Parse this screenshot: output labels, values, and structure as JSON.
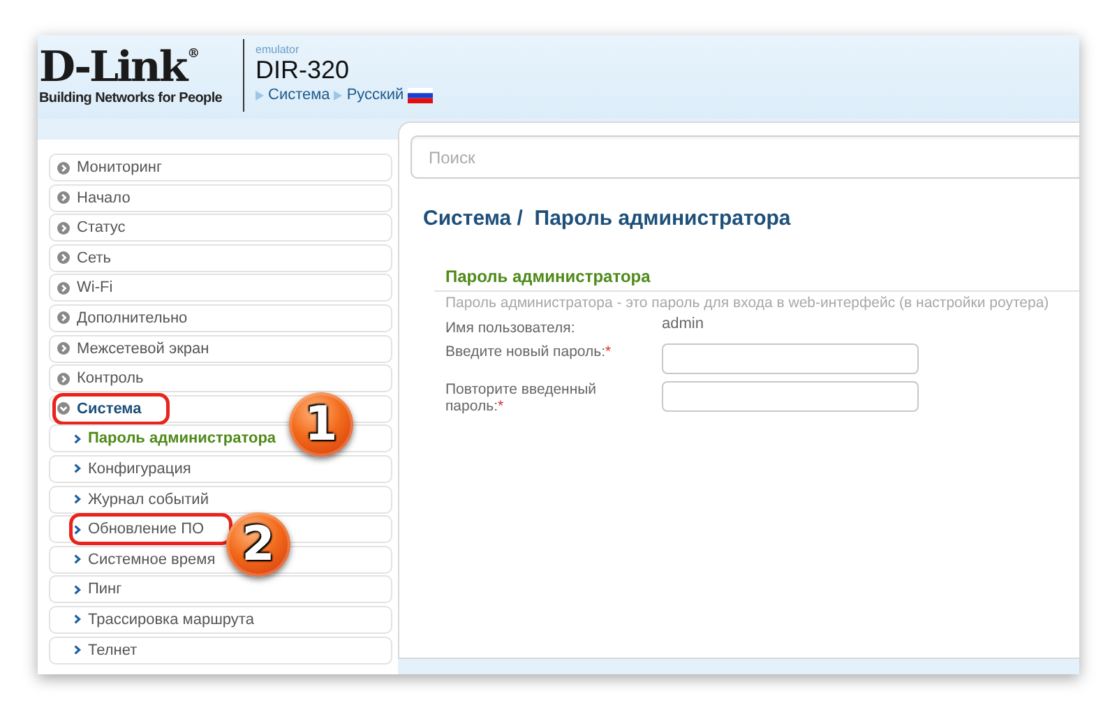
{
  "header": {
    "logo": {
      "wordmark": "D-Link",
      "registered": "®",
      "tagline": "Building Networks for People"
    },
    "emulator_label": "emulator",
    "model": "DIR-320",
    "breadcrumb": [
      {
        "label": "Система",
        "flag": false
      },
      {
        "label": "Русский",
        "flag": true
      }
    ]
  },
  "sidebar": {
    "items": [
      {
        "label": "Мониторинг",
        "expanded": false
      },
      {
        "label": "Начало",
        "expanded": false
      },
      {
        "label": "Статус",
        "expanded": false
      },
      {
        "label": "Сеть",
        "expanded": false
      },
      {
        "label": "Wi-Fi",
        "expanded": false
      },
      {
        "label": "Дополнительно",
        "expanded": false
      },
      {
        "label": "Межсетевой экран",
        "expanded": false
      },
      {
        "label": "Контроль",
        "expanded": false
      },
      {
        "label": "Система",
        "expanded": true,
        "callout": "1",
        "children": [
          {
            "label": "Пароль администратора",
            "selected": true
          },
          {
            "label": "Конфигурация",
            "selected": false
          },
          {
            "label": "Журнал событий",
            "selected": false
          },
          {
            "label": "Обновление ПО",
            "selected": false,
            "callout": "2"
          },
          {
            "label": "Системное время",
            "selected": false
          },
          {
            "label": "Пинг",
            "selected": false
          },
          {
            "label": "Трассировка маршрута",
            "selected": false
          },
          {
            "label": "Телнет",
            "selected": false
          }
        ]
      }
    ]
  },
  "main": {
    "search": {
      "placeholder": "Поиск"
    },
    "page_title": "Система /  Пароль администратора",
    "section": {
      "title": "Пароль администратора",
      "description": "Пароль администратора - это пароль для входа в web-интерфейс (в настройки роутера)",
      "fields": [
        {
          "kind": "text",
          "label": "Имя пользователя:",
          "value": "admin"
        },
        {
          "kind": "password",
          "label": "Введите новый пароль:",
          "required_mark": "*"
        },
        {
          "kind": "password",
          "label": "Повторите введенный пароль:",
          "required_mark": "*"
        }
      ]
    }
  }
}
